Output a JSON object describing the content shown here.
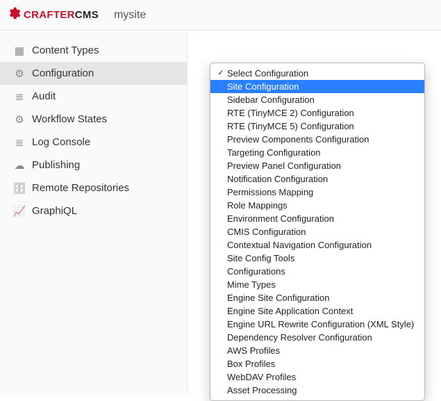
{
  "header": {
    "brand_prefix": "CRAFTER",
    "brand_suffix": "CMS",
    "site_name": "mysite"
  },
  "sidebar": {
    "items": [
      {
        "label": "Content Types",
        "icon": "grid-icon",
        "active": false
      },
      {
        "label": "Configuration",
        "icon": "gear-icon",
        "active": true
      },
      {
        "label": "Audit",
        "icon": "list-icon",
        "active": false
      },
      {
        "label": "Workflow States",
        "icon": "gear-icon",
        "active": false
      },
      {
        "label": "Log Console",
        "icon": "list-icon",
        "active": false
      },
      {
        "label": "Publishing",
        "icon": "cloud-icon",
        "active": false
      },
      {
        "label": "Remote Repositories",
        "icon": "database-icon",
        "active": false
      },
      {
        "label": "GraphiQL",
        "icon": "chart-icon",
        "active": false
      }
    ]
  },
  "dropdown": {
    "items": [
      {
        "label": "Select Configuration",
        "checked": true,
        "highlighted": false
      },
      {
        "label": "Site Configuration",
        "checked": false,
        "highlighted": true
      },
      {
        "label": "Sidebar Configuration",
        "checked": false,
        "highlighted": false
      },
      {
        "label": "RTE (TinyMCE 2) Configuration",
        "checked": false,
        "highlighted": false
      },
      {
        "label": "RTE (TinyMCE 5) Configuration",
        "checked": false,
        "highlighted": false
      },
      {
        "label": "Preview Components Configuration",
        "checked": false,
        "highlighted": false
      },
      {
        "label": "Targeting Configuration",
        "checked": false,
        "highlighted": false
      },
      {
        "label": "Preview Panel Configuration",
        "checked": false,
        "highlighted": false
      },
      {
        "label": "Notification Configuration",
        "checked": false,
        "highlighted": false
      },
      {
        "label": "Permissions Mapping",
        "checked": false,
        "highlighted": false
      },
      {
        "label": "Role Mappings",
        "checked": false,
        "highlighted": false
      },
      {
        "label": "Environment Configuration",
        "checked": false,
        "highlighted": false
      },
      {
        "label": "CMIS Configuration",
        "checked": false,
        "highlighted": false
      },
      {
        "label": "Contextual Navigation Configuration",
        "checked": false,
        "highlighted": false
      },
      {
        "label": "Site Config Tools",
        "checked": false,
        "highlighted": false
      },
      {
        "label": "Configurations",
        "checked": false,
        "highlighted": false
      },
      {
        "label": "Mime Types",
        "checked": false,
        "highlighted": false
      },
      {
        "label": "Engine Site Configuration",
        "checked": false,
        "highlighted": false
      },
      {
        "label": "Engine Site Application Context",
        "checked": false,
        "highlighted": false
      },
      {
        "label": "Engine URL Rewrite Configuration (XML Style)",
        "checked": false,
        "highlighted": false
      },
      {
        "label": "Dependency Resolver Configuration",
        "checked": false,
        "highlighted": false
      },
      {
        "label": "AWS Profiles",
        "checked": false,
        "highlighted": false
      },
      {
        "label": "Box Profiles",
        "checked": false,
        "highlighted": false
      },
      {
        "label": "WebDAV Profiles",
        "checked": false,
        "highlighted": false
      },
      {
        "label": "Asset Processing",
        "checked": false,
        "highlighted": false
      }
    ]
  },
  "icons": {
    "grid-icon": "▦",
    "gear-icon": "⚙",
    "list-icon": "≣",
    "cloud-icon": "☁",
    "database-icon": "🗄",
    "chart-icon": "📈"
  }
}
